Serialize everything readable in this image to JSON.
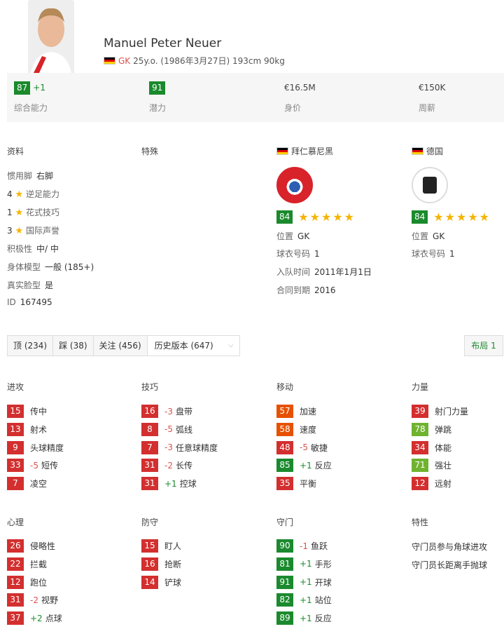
{
  "player": {
    "name": "Manuel Peter Neuer",
    "position": "GK",
    "info": "25y.o. (1986年3月27日) 193cm 90kg"
  },
  "summary": {
    "overall": "87",
    "overall_change": "+1",
    "overall_label": "综合能力",
    "potential": "91",
    "potential_label": "潜力",
    "value": "€16.5M",
    "value_label": "身价",
    "wage": "€150K",
    "wage_label": "周薪"
  },
  "profile": {
    "title": "资料",
    "preferred_foot_label": "惯用脚",
    "preferred_foot": "右脚",
    "weak_foot_num": "4",
    "weak_foot_label": "逆足能力",
    "skill_moves_num": "1",
    "skill_moves_label": "花式技巧",
    "reputation_num": "3",
    "reputation_label": "国际声誉",
    "work_rate_label": "积极性",
    "work_rate": "中/ 中",
    "body_type_label": "身体模型",
    "body_type": "一般 (185+)",
    "real_face_label": "真实脸型",
    "real_face": "是",
    "id_label": "ID",
    "id": "167495"
  },
  "specialties": {
    "title": "特殊"
  },
  "club": {
    "name": "拜仁慕尼黑",
    "rating": "84",
    "position_label": "位置",
    "position": "GK",
    "number_label": "球衣号码",
    "number": "1",
    "joined_label": "入队时间",
    "joined": "2011年1月1日",
    "contract_label": "合同到期",
    "contract": "2016"
  },
  "national": {
    "name": "德国",
    "rating": "84",
    "position_label": "位置",
    "position": "GK",
    "number_label": "球衣号码",
    "number": "1"
  },
  "toolbar": {
    "up": "顶 (234)",
    "down": "踩 (38)",
    "follow": "关注 (456)",
    "history": "历史版本 (647)",
    "layout": "布局 1"
  },
  "sections": {
    "attacking": "进攻",
    "skill": "技巧",
    "movement": "移动",
    "power": "力量",
    "mentality": "心理",
    "defending": "防守",
    "goalkeeping": "守门",
    "traits": "特性"
  },
  "attacking": [
    {
      "value": "15",
      "change": "",
      "label": "传中"
    },
    {
      "value": "13",
      "change": "",
      "label": "射术"
    },
    {
      "value": "9",
      "change": "",
      "label": "头球精度"
    },
    {
      "value": "33",
      "change": "-5",
      "label": "短传"
    },
    {
      "value": "7",
      "change": "",
      "label": "凌空"
    }
  ],
  "skill": [
    {
      "value": "16",
      "change": "-3",
      "label": "盘带"
    },
    {
      "value": "8",
      "change": "-5",
      "label": "弧线"
    },
    {
      "value": "7",
      "change": "-3",
      "label": "任意球精度"
    },
    {
      "value": "31",
      "change": "-2",
      "label": "长传"
    },
    {
      "value": "31",
      "change": "+1",
      "label": "控球"
    }
  ],
  "movement": [
    {
      "value": "57",
      "change": "",
      "label": "加速"
    },
    {
      "value": "58",
      "change": "",
      "label": "速度"
    },
    {
      "value": "48",
      "change": "-5",
      "label": "敏捷"
    },
    {
      "value": "85",
      "change": "+1",
      "label": "反应"
    },
    {
      "value": "35",
      "change": "",
      "label": "平衡"
    }
  ],
  "power": [
    {
      "value": "39",
      "change": "",
      "label": "射门力量"
    },
    {
      "value": "78",
      "change": "",
      "label": "弹跳"
    },
    {
      "value": "34",
      "change": "",
      "label": "体能"
    },
    {
      "value": "71",
      "change": "",
      "label": "强壮"
    },
    {
      "value": "12",
      "change": "",
      "label": "远射"
    }
  ],
  "mentality": [
    {
      "value": "26",
      "change": "",
      "label": "侵略性"
    },
    {
      "value": "22",
      "change": "",
      "label": "拦截"
    },
    {
      "value": "12",
      "change": "",
      "label": "跑位"
    },
    {
      "value": "31",
      "change": "-2",
      "label": "视野"
    },
    {
      "value": "37",
      "change": "+2",
      "label": "点球"
    }
  ],
  "defending": [
    {
      "value": "15",
      "change": "",
      "label": "盯人"
    },
    {
      "value": "16",
      "change": "",
      "label": "抢断"
    },
    {
      "value": "14",
      "change": "",
      "label": "铲球"
    }
  ],
  "goalkeeping": [
    {
      "value": "90",
      "change": "-1",
      "label": "鱼跃"
    },
    {
      "value": "81",
      "change": "+1",
      "label": "手形"
    },
    {
      "value": "91",
      "change": "+1",
      "label": "开球"
    },
    {
      "value": "82",
      "change": "+1",
      "label": "站位"
    },
    {
      "value": "89",
      "change": "+1",
      "label": "反应"
    }
  ],
  "traits": [
    "守门员参与角球进攻",
    "守门员长距离手抛球"
  ],
  "colors": {
    "red": "#d32f2f",
    "orange": "#e65100",
    "lime": "#6fb32f",
    "green": "#1b8a2e"
  },
  "icons": {
    "flag_germany": "germany-flag-icon",
    "star": "star-icon",
    "chevron": "chevron-down-icon"
  }
}
